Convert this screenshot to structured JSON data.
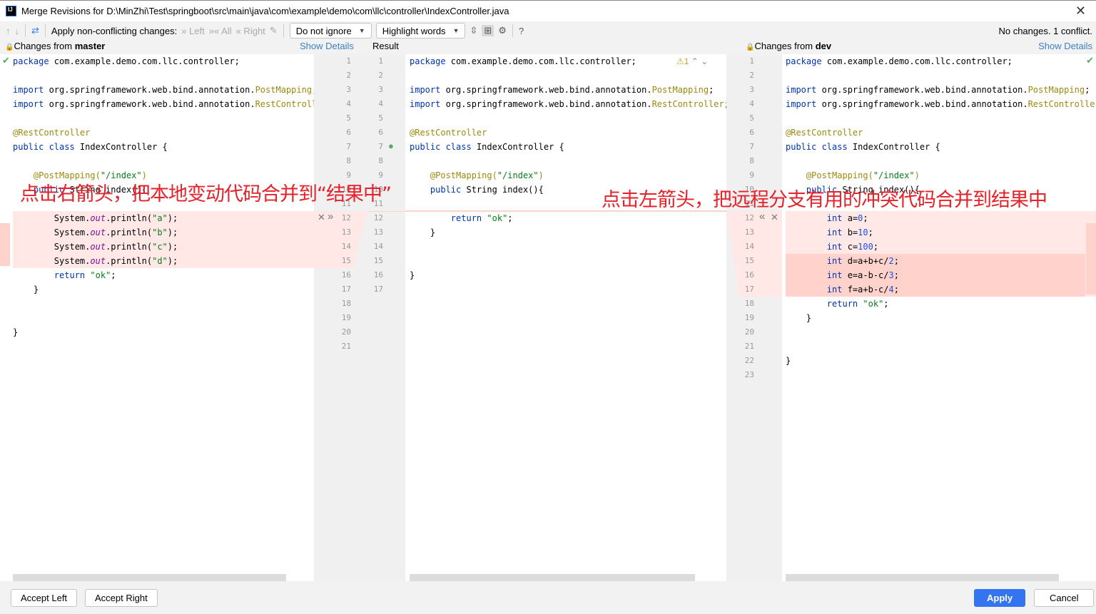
{
  "window": {
    "title": "Merge Revisions for D:\\MinZhi\\Test\\springboot\\src\\main\\java\\com\\example\\demo\\com\\llc\\controller\\IndexController.java",
    "logo": "IJ",
    "close": "✕"
  },
  "toolbar": {
    "prev": "↑",
    "next": "↓",
    "magic": "⇄",
    "apply_label": "Apply non-conflicting changes:",
    "left": "» Left",
    "all": "»« All",
    "right": "« Right",
    "ignore": "Do not ignore",
    "highlight": "Highlight words",
    "collapse": "⇳",
    "sync": "⊞",
    "settings": "⚙",
    "help": "?",
    "status": "No changes. 1 conflict."
  },
  "headers": {
    "left_prefix": "Changes from ",
    "left_branch": "master",
    "left_details": "Show Details",
    "result": "Result",
    "right_prefix": "Changes from ",
    "right_branch": "dev",
    "right_details": "Show Details",
    "lock": "🔒",
    "conflicts": "⚠1",
    "up": "⌃",
    "down": "⌄"
  },
  "left_lines": [
    [
      [
        "package",
        "kw"
      ],
      [
        " com.example.demo.com.llc.controller;",
        ""
      ]
    ],
    [],
    [
      [
        "import",
        "kw"
      ],
      [
        " org.springframework.web.bind.annotation.",
        ""
      ],
      [
        "PostMapping",
        "ann"
      ],
      [
        ";",
        ""
      ]
    ],
    [
      [
        "import",
        "kw"
      ],
      [
        " org.springframework.web.bind.annotation.",
        ""
      ],
      [
        "RestControlle",
        "ann"
      ]
    ],
    [],
    [
      [
        "@RestController",
        "ann"
      ]
    ],
    [
      [
        "public class",
        "kw"
      ],
      [
        " IndexController {",
        ""
      ]
    ],
    [],
    [
      [
        "    @PostMapping(",
        "ann"
      ],
      [
        "\"/index\"",
        "str"
      ],
      [
        ")",
        "ann"
      ]
    ],
    [
      [
        "    public",
        "kw"
      ],
      [
        " String index(){",
        ""
      ]
    ],
    [],
    [
      [
        "        System.",
        ""
      ],
      [
        "out",
        "fld"
      ],
      [
        ".println(",
        ""
      ],
      [
        "\"a\"",
        "str"
      ],
      [
        ");",
        ""
      ]
    ],
    [
      [
        "        System.",
        ""
      ],
      [
        "out",
        "fld"
      ],
      [
        ".println(",
        ""
      ],
      [
        "\"b\"",
        "str"
      ],
      [
        ");",
        ""
      ]
    ],
    [
      [
        "        System.",
        ""
      ],
      [
        "out",
        "fld"
      ],
      [
        ".println(",
        ""
      ],
      [
        "\"c\"",
        "str"
      ],
      [
        ");",
        ""
      ]
    ],
    [
      [
        "        System.",
        ""
      ],
      [
        "out",
        "fld"
      ],
      [
        ".println(",
        ""
      ],
      [
        "\"d\"",
        "str"
      ],
      [
        ");",
        ""
      ]
    ],
    [
      [
        "        return",
        "kw"
      ],
      [
        " ",
        ""
      ],
      [
        "\"ok\"",
        "str"
      ],
      [
        ";",
        ""
      ]
    ],
    [
      [
        "    }",
        ""
      ]
    ],
    [],
    [],
    [
      [
        "}",
        ""
      ]
    ],
    []
  ],
  "result_lines": [
    [
      [
        "package",
        "kw"
      ],
      [
        " com.example.demo.com.llc.controller;",
        ""
      ]
    ],
    [],
    [
      [
        "import",
        "kw"
      ],
      [
        " org.springframework.web.bind.annotation.",
        ""
      ],
      [
        "PostMapping",
        "ann"
      ],
      [
        ";",
        ""
      ]
    ],
    [
      [
        "import",
        "kw"
      ],
      [
        " org.springframework.web.bind.annotation.",
        ""
      ],
      [
        "RestController",
        "ann"
      ],
      [
        ";",
        ""
      ]
    ],
    [],
    [
      [
        "@RestController",
        "ann"
      ]
    ],
    [
      [
        "public class",
        "kw"
      ],
      [
        " IndexController {",
        ""
      ]
    ],
    [],
    [
      [
        "    @PostMapping(",
        "ann"
      ],
      [
        "\"/index\"",
        "str"
      ],
      [
        ")",
        "ann"
      ]
    ],
    [
      [
        "    public",
        "kw"
      ],
      [
        " String index(){",
        ""
      ]
    ],
    [],
    [
      [
        "        return",
        "kw"
      ],
      [
        " ",
        ""
      ],
      [
        "\"ok\"",
        "str"
      ],
      [
        ";",
        ""
      ]
    ],
    [
      [
        "    }",
        ""
      ]
    ],
    [],
    [],
    [
      [
        "}",
        ""
      ]
    ],
    []
  ],
  "right_lines": [
    [
      [
        "package",
        "kw"
      ],
      [
        " com.example.demo.com.llc.controller;",
        ""
      ]
    ],
    [],
    [
      [
        "import",
        "kw"
      ],
      [
        " org.springframework.web.bind.annotation.",
        ""
      ],
      [
        "PostMapping",
        "ann"
      ],
      [
        ";",
        ""
      ]
    ],
    [
      [
        "import",
        "kw"
      ],
      [
        " org.springframework.web.bind.annotation.",
        ""
      ],
      [
        "RestController",
        "ann"
      ],
      [
        ";",
        ""
      ]
    ],
    [],
    [
      [
        "@RestController",
        "ann"
      ]
    ],
    [
      [
        "public class",
        "kw"
      ],
      [
        " IndexController {",
        ""
      ]
    ],
    [],
    [
      [
        "    @PostMapping(",
        "ann"
      ],
      [
        "\"/index\"",
        "str"
      ],
      [
        ")",
        "ann"
      ]
    ],
    [
      [
        "    public",
        "kw"
      ],
      [
        " String index(){",
        ""
      ]
    ],
    [],
    [
      [
        "        int",
        "kw"
      ],
      [
        " a=",
        ""
      ],
      [
        "0",
        "num"
      ],
      [
        ";",
        ""
      ]
    ],
    [
      [
        "        int",
        "kw"
      ],
      [
        " b=",
        ""
      ],
      [
        "10",
        "num"
      ],
      [
        ";",
        ""
      ]
    ],
    [
      [
        "        int",
        "kw"
      ],
      [
        " c=",
        ""
      ],
      [
        "100",
        "num"
      ],
      [
        ";",
        ""
      ]
    ],
    [
      [
        "        int",
        "kw"
      ],
      [
        " d=a+b+c/",
        ""
      ],
      [
        "2",
        "num"
      ],
      [
        ";",
        ""
      ]
    ],
    [
      [
        "        int",
        "kw"
      ],
      [
        " e=a-b-c/",
        ""
      ],
      [
        "3",
        "num"
      ],
      [
        ";",
        ""
      ]
    ],
    [
      [
        "        int",
        "kw"
      ],
      [
        " f=a+b-c/",
        ""
      ],
      [
        "4",
        "num"
      ],
      [
        ";",
        ""
      ]
    ],
    [
      [
        "        return",
        "kw"
      ],
      [
        " ",
        ""
      ],
      [
        "\"ok\"",
        "str"
      ],
      [
        ";",
        ""
      ]
    ],
    [
      [
        "    }",
        ""
      ]
    ],
    [],
    [],
    [
      [
        "}",
        ""
      ]
    ],
    []
  ],
  "gutter": {
    "left_nums": 21,
    "result_nums": 17,
    "right_nums": 23,
    "accept_left_arrow": "»",
    "reject": "✕",
    "accept_right_arrow": "«"
  },
  "annotations": {
    "left": "点击右箭头，把本地变动代码合并到“结果中”",
    "right": "点击左箭头，把远程分支有用的冲突代码合并到结果中"
  },
  "footer": {
    "accept_left": "Accept Left",
    "accept_right": "Accept Right",
    "apply": "Apply",
    "cancel": "Cancel"
  },
  "colors": {
    "conflict": "#ffe8e6",
    "conflict_strong": "#ffd3cc",
    "accent": "#3574f0",
    "annotation": "#e8202a"
  }
}
